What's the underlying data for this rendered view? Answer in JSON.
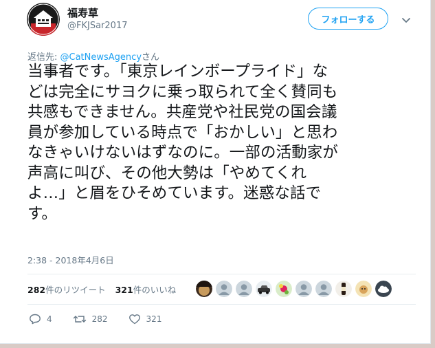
{
  "author": {
    "display_name": "福寿草",
    "screen_name": "@FKJSar2017",
    "avatar_icon": "house-crest-avatar-icon"
  },
  "follow_button": {
    "label": "フォローする"
  },
  "menu_icon": "chevron-down-icon",
  "reply_context": {
    "prefix": "返信先: ",
    "handle": "@CatNewsAgency",
    "suffix": "さん"
  },
  "tweet": {
    "text": "当事者です。「東京レインボープライド」な\nどは完全にサヨクに乗っ取られて全く賛同も\n共感もできません。共産党や社民党の国会議\n員が参加している時点で「おかしい」と思わ\nなきゃいけないはずなのに。一部の活動家が\n声高に叫び、その他大勢は「やめてくれ\nよ…」と眉をひそめています。迷惑な話で\nす。",
    "timestamp": "2:38 - 2018年4月6日"
  },
  "stats": {
    "retweets_count": "282",
    "retweets_label": "件のリツイート",
    "likes_count": "321",
    "likes_label": "件のいいね"
  },
  "liker_avatars": [
    "photo-avatar-icon",
    "default-avatar-icon",
    "default-avatar-icon",
    "car-avatar-icon",
    "flower-avatar-icon",
    "default-avatar-icon",
    "default-avatar-icon",
    "bottle-avatar-icon",
    "cartoon-avatar-icon",
    "cloud-avatar-icon"
  ],
  "actions": {
    "reply_count": "4",
    "retweet_count": "282",
    "like_count": "321"
  },
  "colors": {
    "accent": "#1da1f2",
    "secondary_text": "#657786",
    "page_background": "#d9cbc6"
  }
}
